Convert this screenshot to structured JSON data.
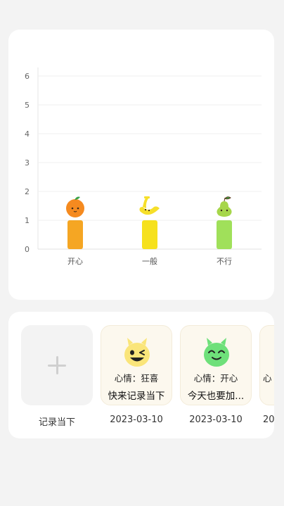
{
  "chart_data": {
    "type": "bar",
    "categories": [
      "开心",
      "一般",
      "不行"
    ],
    "values": [
      1,
      1,
      1
    ],
    "y_ticks": [
      "0",
      "1",
      "2",
      "3",
      "4",
      "5",
      "6"
    ],
    "ylim": [
      0,
      6.3
    ],
    "grid": true,
    "colors": [
      "#f5a623",
      "#f6e11d",
      "#a0e05a"
    ],
    "icons": [
      "orange-icon",
      "banana-icon",
      "pear-icon"
    ]
  },
  "records": {
    "add_caption": "记录当下",
    "items": [
      {
        "label": "心情：狂喜",
        "text": "快来记录当下",
        "date": "2023-03-10",
        "face_color": "#fae57a",
        "icon": "winking-yellow-face-icon"
      },
      {
        "label": "心情：开心",
        "text": "今天也要加...",
        "date": "2023-03-10",
        "face_color": "#6ee07a",
        "icon": "happy-green-face-icon"
      },
      {
        "label": "心",
        "text": "",
        "date": "20",
        "face_color": "#fae57a",
        "icon": "partial-face-icon"
      }
    ]
  }
}
